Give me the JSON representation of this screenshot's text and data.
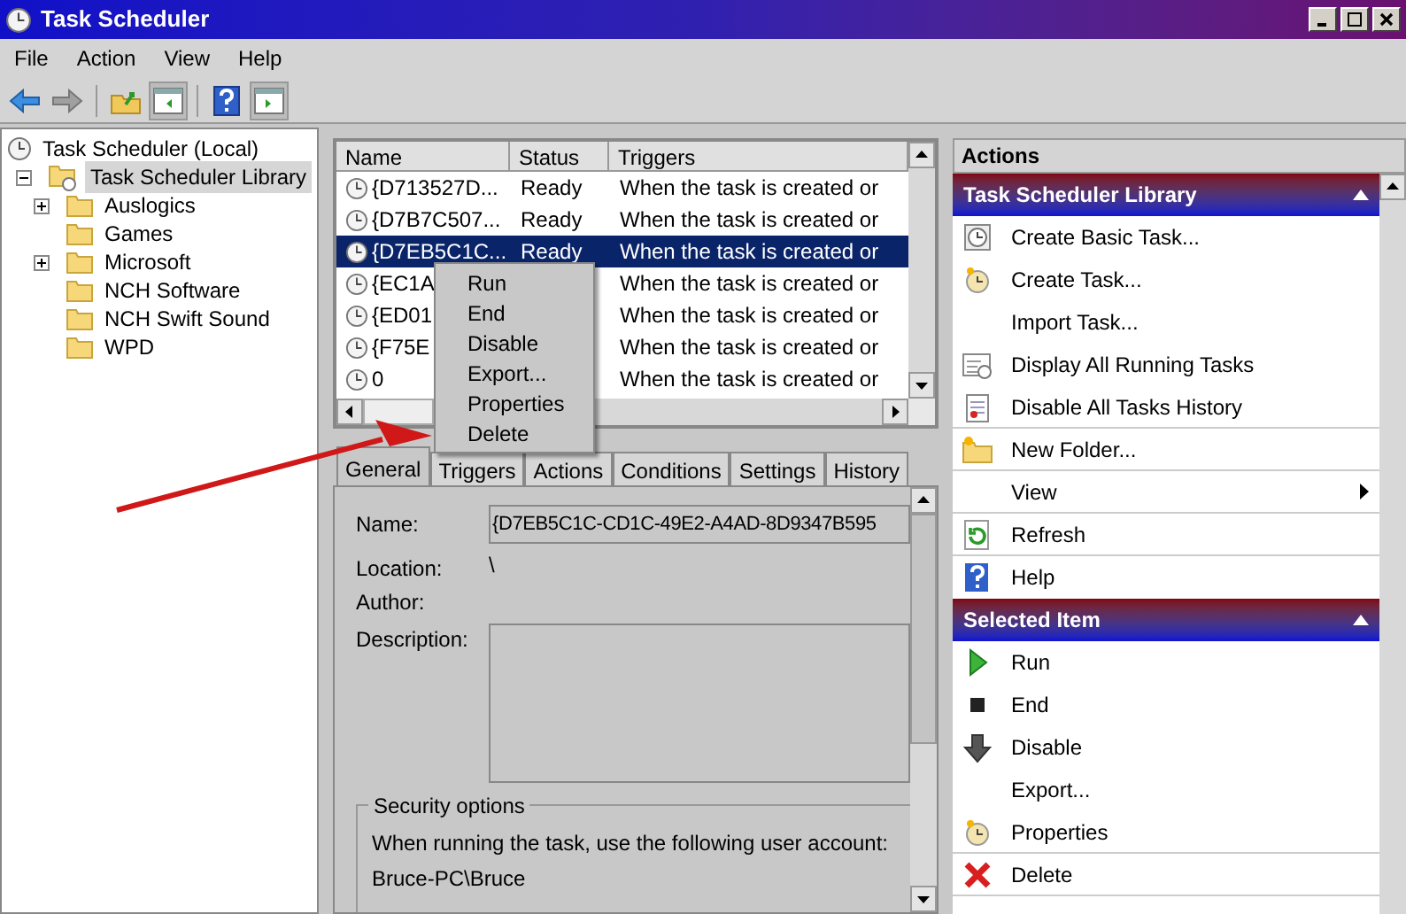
{
  "window": {
    "title": "Task Scheduler"
  },
  "menu": [
    "File",
    "Action",
    "View",
    "Help"
  ],
  "toolbar": [
    {
      "pressed": false
    },
    {
      "pressed": false
    },
    {
      "pressed": false
    },
    {
      "pressed": true
    },
    {
      "pressed": false
    },
    {
      "pressed": true
    }
  ],
  "tree": [
    {
      "label": "Task Scheduler (Local)",
      "selected": false,
      "children": [
        {
          "label": "Task Scheduler Library",
          "selected": true,
          "expanded": true,
          "children": [
            {
              "label": "Auslogics",
              "selected": false,
              "expanded": false
            },
            {
              "label": "Games",
              "selected": false
            },
            {
              "label": "Microsoft",
              "selected": false,
              "expanded": false
            },
            {
              "label": "NCH Software",
              "selected": false
            },
            {
              "label": "NCH Swift Sound",
              "selected": false
            },
            {
              "label": "WPD",
              "selected": false
            }
          ]
        }
      ]
    }
  ],
  "table": {
    "columns": [
      "Name",
      "Status",
      "Triggers"
    ],
    "rows": [
      {
        "name": "{D713527D...",
        "status": "Ready",
        "trigger": "When the task is created or",
        "selected": false
      },
      {
        "name": "{D7B7C507...",
        "status": "Ready",
        "trigger": "When the task is created or",
        "selected": false
      },
      {
        "name": "{D7EB5C1C...",
        "status": "Ready",
        "trigger": "When the task is created or",
        "selected": true
      },
      {
        "name": "{EC1A",
        "trigger": "When the task is created or",
        "selected": false
      },
      {
        "name": "{ED01",
        "trigger": "When the task is created or",
        "selected": false
      },
      {
        "name": "{F75E",
        "trigger": "When the task is created or",
        "selected": false
      },
      {
        "name": "0",
        "trigger": "When the task is created or",
        "selected": false
      }
    ]
  },
  "context_menu": [
    "Run",
    "End",
    "Disable",
    "Export...",
    "Properties",
    "Delete"
  ],
  "detail_tabs": [
    {
      "label": "General",
      "selected": true
    },
    {
      "label": "Triggers",
      "selected": false
    },
    {
      "label": "Actions",
      "selected": false
    },
    {
      "label": "Conditions",
      "selected": false
    },
    {
      "label": "Settings",
      "selected": false
    },
    {
      "label": "History",
      "selected": false
    }
  ],
  "general": {
    "name_label": "Name:",
    "name_value": "{D7EB5C1C-CD1C-49E2-A4AD-8D9347B595",
    "location_label": "Location:",
    "location_value": "\\",
    "author_label": "Author:",
    "description_label": "Description:",
    "security_title": "Security options",
    "security_text": "When running the task, use the following user account:",
    "account": "Bruce-PC\\Bruce"
  },
  "actions": {
    "title": "Actions",
    "sections": [
      {
        "title": "Task Scheduler Library",
        "items": [
          {
            "label": "Create Basic Task...",
            "divider_after": false,
            "submenu": false
          },
          {
            "label": "Create Task...",
            "divider_after": false,
            "submenu": false
          },
          {
            "label": "Import Task...",
            "divider_after": false,
            "submenu": false
          },
          {
            "label": "Display All Running Tasks",
            "divider_after": false,
            "submenu": false
          },
          {
            "label": "Disable All Tasks History",
            "divider_after": true,
            "submenu": false
          },
          {
            "label": "New Folder...",
            "divider_after": true,
            "submenu": false
          },
          {
            "label": "View",
            "divider_after": true,
            "submenu": true
          },
          {
            "label": "Refresh",
            "divider_after": true,
            "submenu": false
          },
          {
            "label": "Help",
            "divider_after": false,
            "submenu": false
          }
        ]
      },
      {
        "title": "Selected Item",
        "items": [
          {
            "label": "Run",
            "divider_after": false,
            "submenu": false
          },
          {
            "label": "End",
            "divider_after": false,
            "submenu": false
          },
          {
            "label": "Disable",
            "divider_after": false,
            "submenu": false
          },
          {
            "label": "Export...",
            "divider_after": false,
            "submenu": false
          },
          {
            "label": "Properties",
            "divider_after": true,
            "submenu": false
          },
          {
            "label": "Delete",
            "divider_after": true,
            "submenu": false
          }
        ]
      }
    ]
  }
}
